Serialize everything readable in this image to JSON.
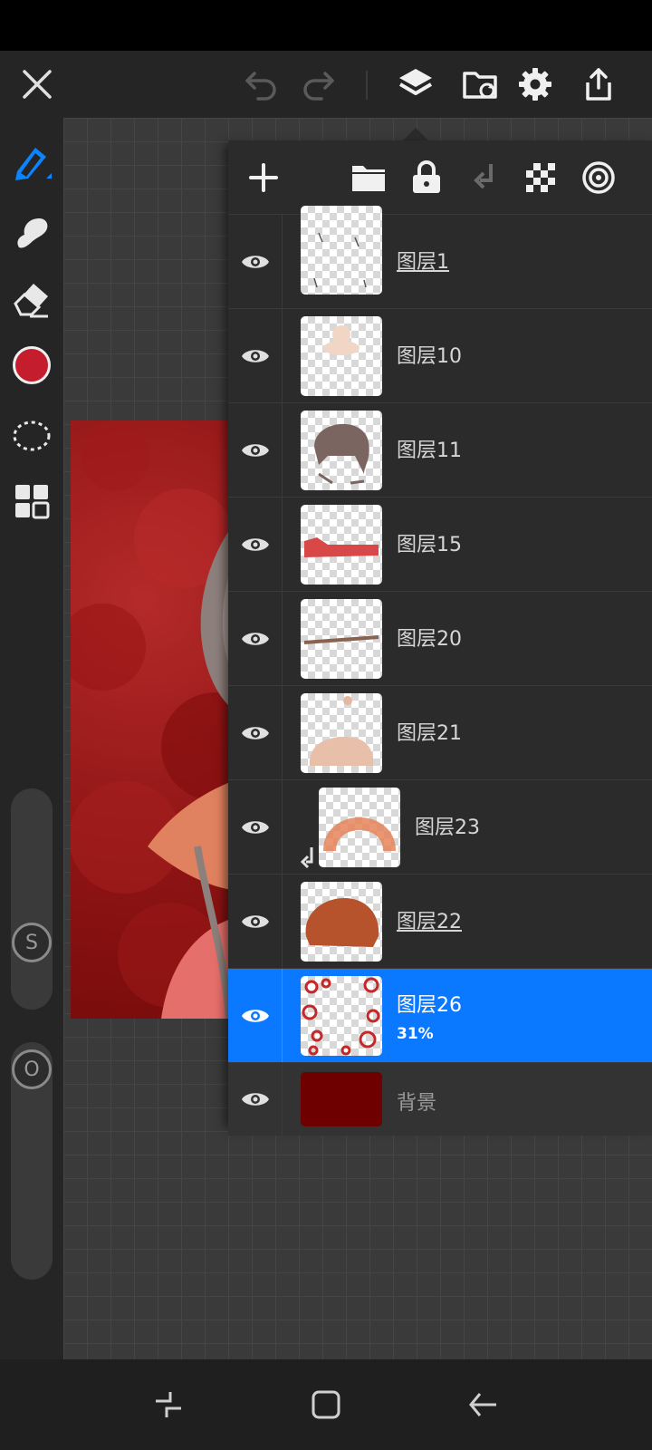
{
  "layers_panel": {
    "layers": [
      {
        "name": "图层1",
        "underlined": true,
        "clipped": false,
        "opacity": "",
        "selected": false
      },
      {
        "name": "图层10",
        "underlined": false,
        "clipped": false,
        "opacity": "",
        "selected": false
      },
      {
        "name": "图层11",
        "underlined": false,
        "clipped": false,
        "opacity": "",
        "selected": false
      },
      {
        "name": "图层15",
        "underlined": false,
        "clipped": false,
        "opacity": "",
        "selected": false
      },
      {
        "name": "图层20",
        "underlined": false,
        "clipped": false,
        "opacity": "",
        "selected": false
      },
      {
        "name": "图层21",
        "underlined": false,
        "clipped": false,
        "opacity": "",
        "selected": false
      },
      {
        "name": "图层23",
        "underlined": false,
        "clipped": true,
        "opacity": "",
        "selected": false
      },
      {
        "name": "图层22",
        "underlined": true,
        "clipped": false,
        "opacity": "",
        "selected": false
      },
      {
        "name": "图层26",
        "underlined": false,
        "clipped": false,
        "opacity": "31%",
        "selected": true
      }
    ],
    "background_layer": {
      "name": "背景",
      "color": "#6e0000"
    }
  },
  "left_toolbar": {
    "color_swatch": "#c41e2e",
    "size_slider_label": "S",
    "opacity_slider_label": "O"
  },
  "colors": {
    "accent": "#0a78ff",
    "panel": "#2b2b2b",
    "toolbar": "#252525"
  }
}
